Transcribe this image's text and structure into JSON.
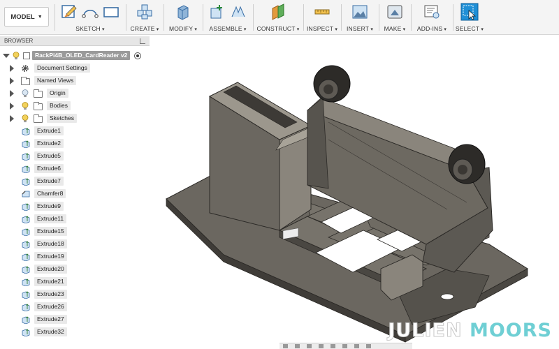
{
  "app": {
    "model_label": "MODEL"
  },
  "toolbar": {
    "groups": [
      {
        "label": "SKETCH"
      },
      {
        "label": "CREATE"
      },
      {
        "label": "MODIFY"
      },
      {
        "label": "ASSEMBLE"
      },
      {
        "label": "CONSTRUCT"
      },
      {
        "label": "INSPECT"
      },
      {
        "label": "INSERT"
      },
      {
        "label": "MAKE"
      },
      {
        "label": "ADD-INS"
      },
      {
        "label": "SELECT"
      }
    ]
  },
  "browser": {
    "title": "BROWSER",
    "root": "RackPi4B_OLED_CardReader v2",
    "folders": [
      {
        "label": "Document Settings",
        "icon": "gear-icon"
      },
      {
        "label": "Named Views",
        "icon": "folder-icon"
      },
      {
        "label": "Origin",
        "icon": "folder-icon"
      },
      {
        "label": "Bodies",
        "icon": "folder-icon"
      },
      {
        "label": "Sketches",
        "icon": "folder-icon"
      }
    ],
    "features": [
      {
        "label": "Extrude1",
        "icon": "extrude-icon"
      },
      {
        "label": "Extrude2",
        "icon": "extrude-icon"
      },
      {
        "label": "Extrude5",
        "icon": "extrude-icon"
      },
      {
        "label": "Extrude6",
        "icon": "extrude-icon"
      },
      {
        "label": "Extrude7",
        "icon": "extrude-icon"
      },
      {
        "label": "Chamfer8",
        "icon": "chamfer-icon"
      },
      {
        "label": "Extrude9",
        "icon": "extrude-icon"
      },
      {
        "label": "Extrude11",
        "icon": "extrude-icon"
      },
      {
        "label": "Extrude15",
        "icon": "extrude-icon"
      },
      {
        "label": "Extrude18",
        "icon": "extrude-icon"
      },
      {
        "label": "Extrude19",
        "icon": "extrude-icon"
      },
      {
        "label": "Extrude20",
        "icon": "extrude-icon"
      },
      {
        "label": "Extrude21",
        "icon": "extrude-icon"
      },
      {
        "label": "Extrude23",
        "icon": "extrude-icon"
      },
      {
        "label": "Extrude26",
        "icon": "extrude-icon"
      },
      {
        "label": "Extrude27",
        "icon": "extrude-icon"
      },
      {
        "label": "Extrude32",
        "icon": "extrude-icon"
      }
    ]
  },
  "watermark": {
    "first": "JULIEN",
    "second": "MOORS"
  },
  "colors": {
    "model_gray": "#6b6760",
    "model_dark": "#3f3c38",
    "select_blue": "#1f8fd6",
    "watermark_accent": "#6fcfd4"
  }
}
